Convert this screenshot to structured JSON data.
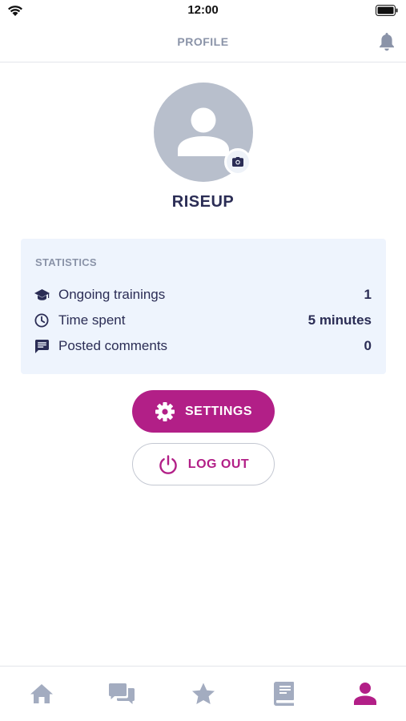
{
  "status_bar": {
    "time": "12:00"
  },
  "header": {
    "title": "PROFILE",
    "bell_icon": "bell-icon"
  },
  "profile": {
    "username": "RISEUP",
    "avatar_icon": "user-placeholder-icon",
    "camera_icon": "camera-icon"
  },
  "statistics": {
    "title": "STATISTICS",
    "rows": [
      {
        "icon": "graduation-cap-icon",
        "label": "Ongoing trainings",
        "value": "1"
      },
      {
        "icon": "clock-icon",
        "label": "Time spent",
        "value": "5 minutes"
      },
      {
        "icon": "comment-icon",
        "label": "Posted comments",
        "value": "0"
      }
    ]
  },
  "actions": {
    "settings_label": "SETTINGS",
    "settings_icon": "gear-icon",
    "logout_label": "LOG OUT",
    "logout_icon": "power-icon"
  },
  "tab_bar": {
    "tabs": [
      {
        "icon": "home-icon",
        "active": false
      },
      {
        "icon": "chat-icon",
        "active": false
      },
      {
        "icon": "star-icon",
        "active": false
      },
      {
        "icon": "book-icon",
        "active": false
      },
      {
        "icon": "profile-icon",
        "active": true
      }
    ]
  },
  "colors": {
    "accent": "#b21f87",
    "text_primary": "#2b2d55",
    "text_muted": "#8a93a8",
    "tab_inactive": "#a3acc0",
    "card_background": "#eef4fd"
  }
}
